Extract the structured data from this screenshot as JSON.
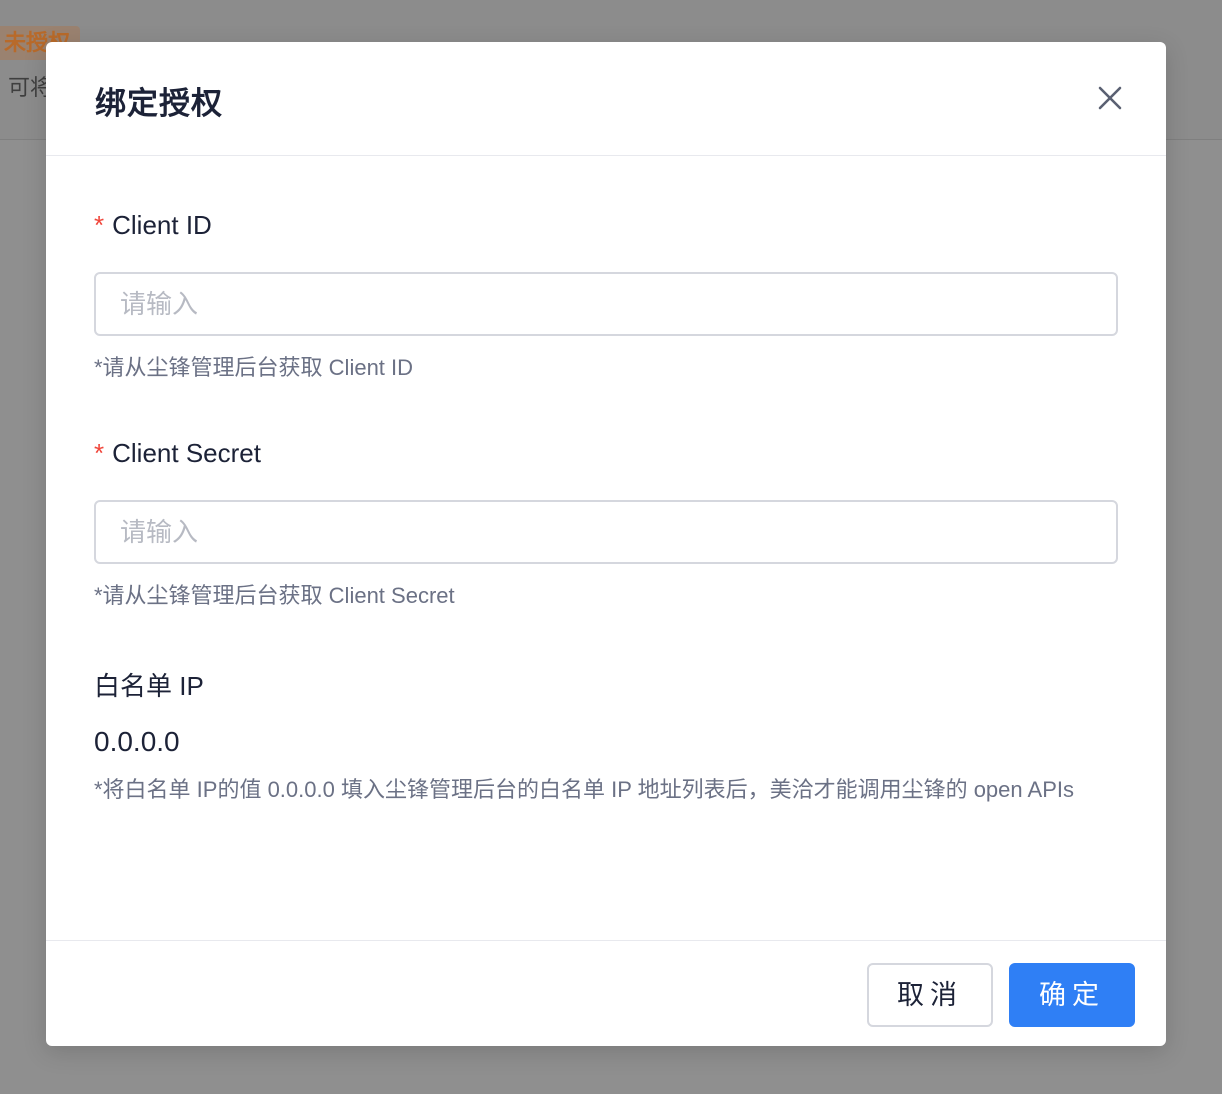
{
  "background": {
    "badge_text": "未授权",
    "desc_text": "可将"
  },
  "modal": {
    "title": "绑定授权",
    "close_icon": "close-icon",
    "fields": [
      {
        "label": "Client ID",
        "required_mark": "*",
        "placeholder": "请输入",
        "value": "",
        "hint": "*请从尘锋管理后台获取 Client ID"
      },
      {
        "label": "Client Secret",
        "required_mark": "*",
        "placeholder": "请输入",
        "value": "",
        "hint": "*请从尘锋管理后台获取 Client Secret"
      }
    ],
    "whitelist": {
      "label": "白名单 IP",
      "value": "0.0.0.0",
      "hint": "*将白名单 IP的值 0.0.0.0 填入尘锋管理后台的白名单 IP 地址列表后，美洽才能调用尘锋的 open APIs"
    },
    "footer": {
      "cancel_label": "取消",
      "ok_label": "确定"
    }
  },
  "colors": {
    "primary": "#2f7ff5",
    "required": "#f0463b",
    "text": "#1c2237",
    "hint": "#6b7185",
    "overlay": "#8c8c8c"
  }
}
